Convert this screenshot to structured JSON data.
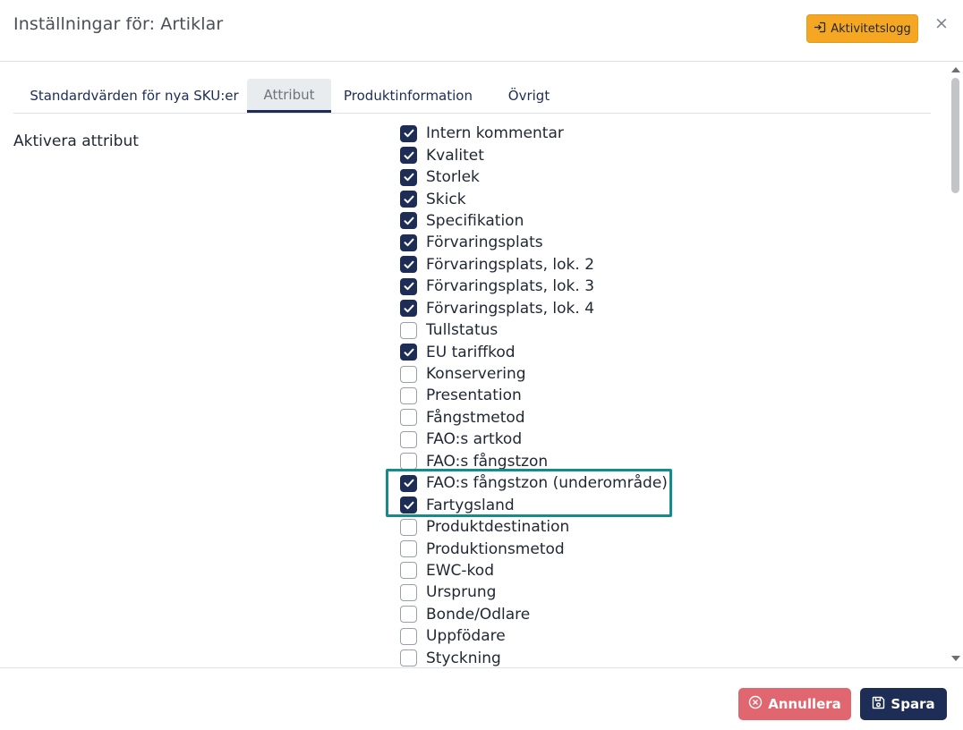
{
  "header": {
    "title": "Inställningar för: Artiklar",
    "log_button": "Aktivitetslogg",
    "close": "×"
  },
  "tabs": [
    {
      "label": "Standardvärden för nya SKU:er",
      "active": false
    },
    {
      "label": "Attribut",
      "active": true
    },
    {
      "label": "Produktinformation",
      "active": false
    },
    {
      "label": "Övrigt",
      "active": false
    }
  ],
  "section": {
    "label": "Aktivera attribut"
  },
  "attributes": [
    {
      "label": "Intern kommentar",
      "checked": true
    },
    {
      "label": "Kvalitet",
      "checked": true
    },
    {
      "label": "Storlek",
      "checked": true
    },
    {
      "label": "Skick",
      "checked": true
    },
    {
      "label": "Specifikation",
      "checked": true
    },
    {
      "label": "Förvaringsplats",
      "checked": true
    },
    {
      "label": "Förvaringsplats, lok. 2",
      "checked": true
    },
    {
      "label": "Förvaringsplats, lok. 3",
      "checked": true
    },
    {
      "label": "Förvaringsplats, lok. 4",
      "checked": true
    },
    {
      "label": "Tullstatus",
      "checked": false
    },
    {
      "label": "EU tariffkod",
      "checked": true
    },
    {
      "label": "Konservering",
      "checked": false
    },
    {
      "label": "Presentation",
      "checked": false
    },
    {
      "label": "Fångstmetod",
      "checked": false
    },
    {
      "label": "FAO:s artkod",
      "checked": false
    },
    {
      "label": "FAO:s fångstzon",
      "checked": false
    },
    {
      "label": "FAO:s fångstzon (underområde)",
      "checked": true
    },
    {
      "label": "Fartygsland",
      "checked": true
    },
    {
      "label": "Produktdestination",
      "checked": false
    },
    {
      "label": "Produktionsmetod",
      "checked": false
    },
    {
      "label": "EWC-kod",
      "checked": false
    },
    {
      "label": "Ursprung",
      "checked": false
    },
    {
      "label": "Bonde/Odlare",
      "checked": false
    },
    {
      "label": "Uppfödare",
      "checked": false
    },
    {
      "label": "Styckning",
      "checked": false
    }
  ],
  "footer": {
    "cancel_label": "Annullera",
    "save_label": "Spara"
  },
  "colors": {
    "primary": "#1e2d55",
    "warning": "#f5a623",
    "danger": "#e06670",
    "highlight": "#138c8f"
  },
  "icons": {
    "log": "sign-in-icon",
    "cancel": "times-circle-icon",
    "save": "floppy-disk-icon",
    "check": "check-icon"
  }
}
